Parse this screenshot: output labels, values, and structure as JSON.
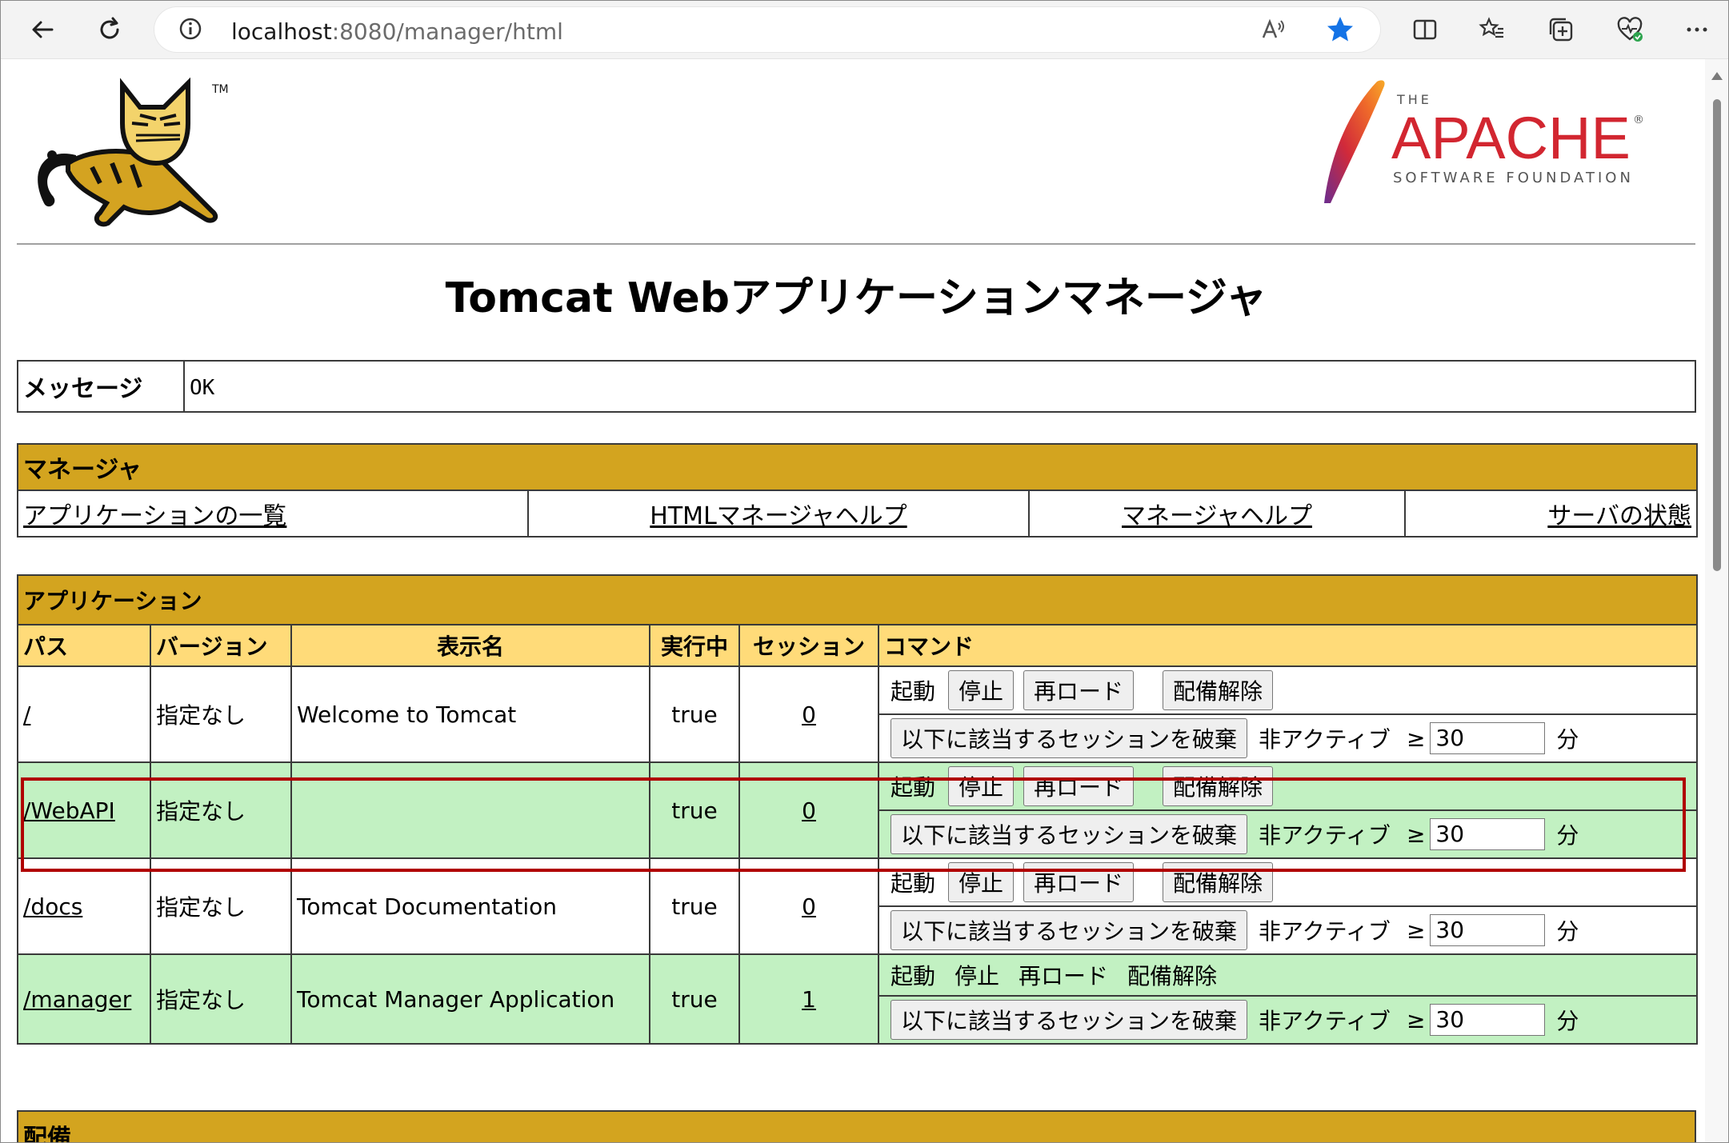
{
  "browser": {
    "url_host": "localhost",
    "url_path": ":8080/manager/html"
  },
  "page": {
    "title": "Tomcat Webアプリケーションマネージャ"
  },
  "message": {
    "label": "メッセージ",
    "value": "OK"
  },
  "manager": {
    "header": "マネージャ",
    "links": [
      "アプリケーションの一覧",
      "HTMLマネージャヘルプ",
      "マネージャヘルプ",
      "サーバの状態"
    ]
  },
  "applications": {
    "header": "アプリケーション",
    "columns": [
      "パス",
      "バージョン",
      "表示名",
      "実行中",
      "セッション",
      "コマンド"
    ],
    "commands": {
      "start": "起動",
      "stop": "停止",
      "reload": "再ロード",
      "undeploy": "配備解除",
      "expire": "以下に該当するセッションを破棄",
      "idle_label": "非アクティブ",
      "ge": "≥",
      "minutes": "分"
    },
    "rows": [
      {
        "path": "/",
        "version": "指定なし",
        "display_name": "Welcome to Tomcat",
        "running": "true",
        "sessions": "0",
        "idle": "30"
      },
      {
        "path": "/WebAPI",
        "version": "指定なし",
        "display_name": "",
        "running": "true",
        "sessions": "0",
        "idle": "30"
      },
      {
        "path": "/docs",
        "version": "指定なし",
        "display_name": "Tomcat Documentation",
        "running": "true",
        "sessions": "0",
        "idle": "30"
      },
      {
        "path": "/manager",
        "version": "指定なし",
        "display_name": "Tomcat Manager Application",
        "running": "true",
        "sessions": "1",
        "idle": "30"
      }
    ]
  },
  "deploy": {
    "header": "配備"
  },
  "logos": {
    "tomcat_tm": "TM",
    "apache_the": "THE",
    "apache_name": "APACHE",
    "apache_sub": "SOFTWARE FOUNDATION",
    "apache_r": "®"
  }
}
